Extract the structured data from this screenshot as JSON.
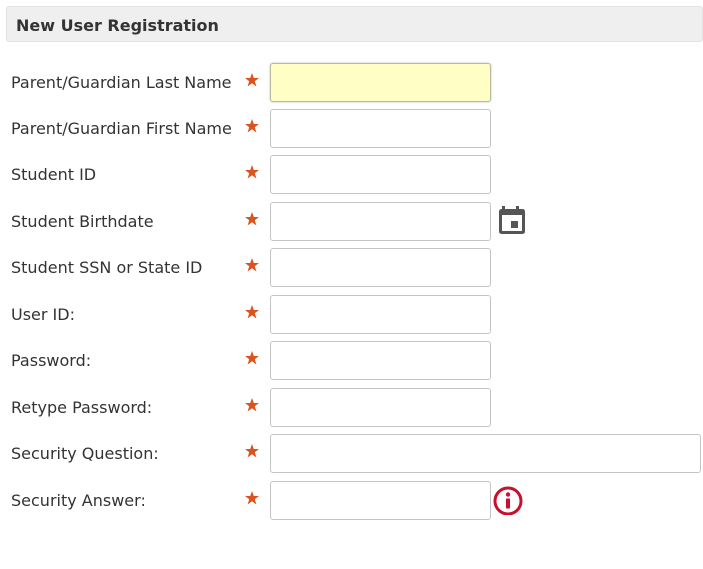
{
  "panel": {
    "title": "New User Registration"
  },
  "colors": {
    "required_star": "#d9541e",
    "focused_field_bg": "#ffffc5",
    "info_icon": "#c8102e",
    "calendar_icon": "#555555",
    "header_bg": "#efefef"
  },
  "fields": [
    {
      "label": "Parent/Guardian Last Name",
      "value": "",
      "placeholder": "",
      "required": true,
      "focused": true
    },
    {
      "label": "Parent/Guardian First Name",
      "value": "",
      "placeholder": "",
      "required": true
    },
    {
      "label": "Student ID",
      "value": "",
      "placeholder": "",
      "required": true
    },
    {
      "label": "Student Birthdate",
      "value": "",
      "placeholder": "",
      "required": true,
      "icon": "calendar-icon"
    },
    {
      "label": "Student SSN or State ID",
      "value": "",
      "placeholder": "",
      "required": true
    },
    {
      "label": "User ID:",
      "value": "",
      "placeholder": "",
      "required": true
    },
    {
      "label": "Password:",
      "value": "",
      "placeholder": "",
      "required": true
    },
    {
      "label": "Retype Password:",
      "value": "",
      "placeholder": "",
      "required": true
    },
    {
      "label": "Security Question:",
      "value": "",
      "placeholder": "",
      "required": true
    },
    {
      "label": "Security Answer:",
      "value": "",
      "placeholder": "",
      "required": true,
      "icon": "info-icon"
    }
  ]
}
